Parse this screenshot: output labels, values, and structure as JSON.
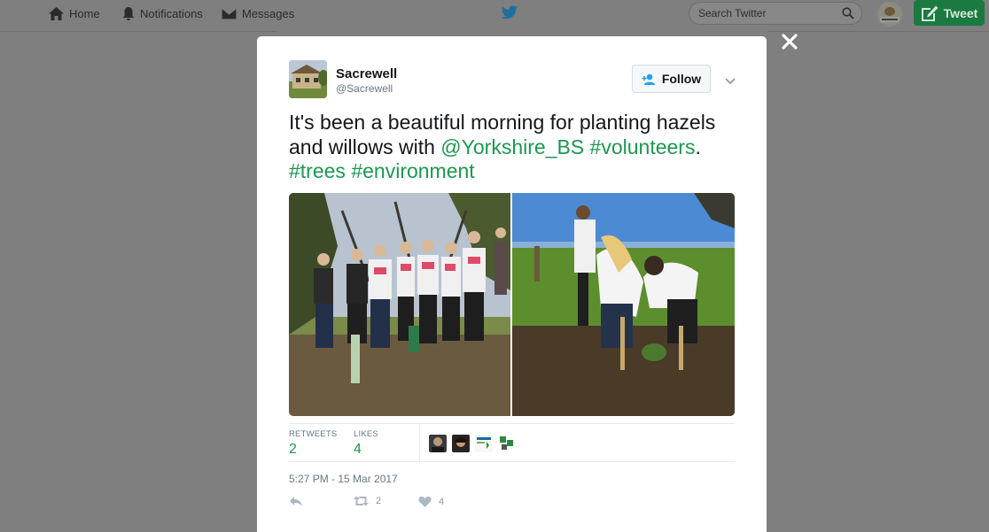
{
  "nav": {
    "home": "Home",
    "notifications": "Notifications",
    "messages": "Messages",
    "search_placeholder": "Search Twitter",
    "tweet_button": "Tweet"
  },
  "tweet": {
    "display_name": "Sacrewell",
    "handle": "@Sacrewell",
    "follow_label": "Follow",
    "text_line1": "It's been a beautiful morning for planting hazels",
    "text_line2_pre": "and willows with ",
    "mention": "@Yorkshire_BS",
    "space": " ",
    "hashtag_volunteers": "#volunteers",
    "period": ".",
    "hashtag_trees": "#trees",
    "hashtag_environment": "#environment",
    "retweets_label": "RETWEETS",
    "retweets_count": "2",
    "likes_label": "LIKES",
    "likes_count": "4",
    "timestamp": "5:27 PM - 15 Mar 2017",
    "action_retweet_count": "2",
    "action_like_count": "4"
  },
  "colors": {
    "link": "#1a9950",
    "tweet_button": "#1a7a40",
    "overlay": "#7f7f7f"
  },
  "icons": [
    "home-icon",
    "notifications-icon",
    "messages-icon",
    "twitter-bird-icon",
    "search-icon",
    "follow-person-icon",
    "chevron-down-icon",
    "close-icon",
    "reply-icon",
    "retweet-icon",
    "like-icon",
    "compose-icon"
  ]
}
